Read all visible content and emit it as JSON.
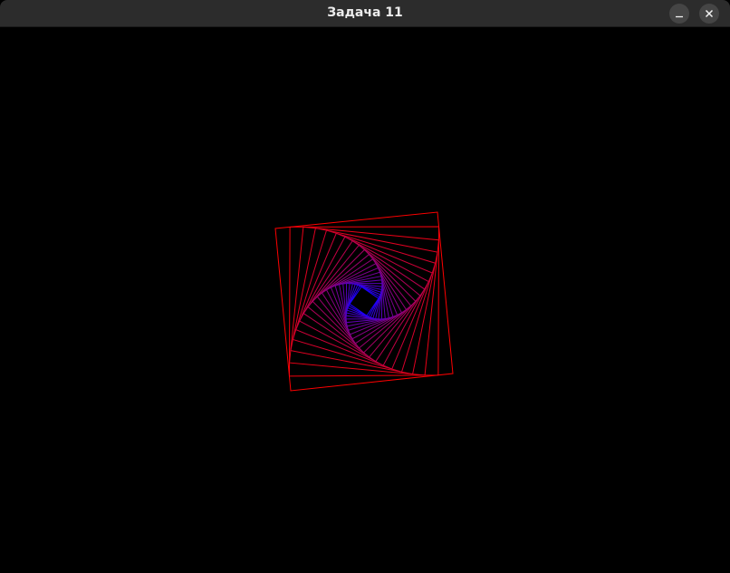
{
  "window": {
    "title": "Задача 11",
    "controls": {
      "minimize_icon": "minimize-icon",
      "close_icon": "close-icon"
    }
  },
  "figure": {
    "description_kind": "nested rotating squares",
    "layers": 24,
    "outer_color": "#ff0000",
    "inner_color": "#1a00ff",
    "background": "#000000"
  }
}
